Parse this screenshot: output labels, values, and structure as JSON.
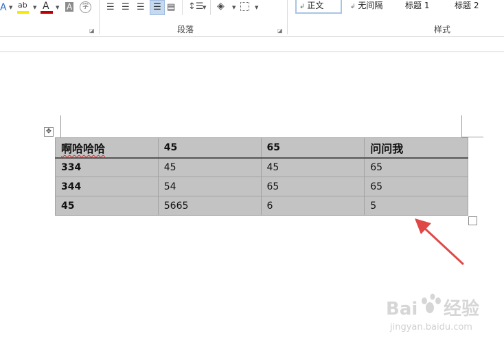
{
  "ribbon": {
    "font_icons": [
      "text-effects-icon",
      "highlight-icon",
      "font-color-icon",
      "character-shading-icon",
      "enclosed-character-icon"
    ],
    "paragraph_group_label": "段落",
    "styles_group_label": "样式",
    "styles": [
      {
        "prefix": "↲",
        "label": "正文",
        "selected": true
      },
      {
        "prefix": "↲",
        "label": "无间隔",
        "selected": false
      },
      {
        "prefix": "",
        "label": "标题 1",
        "selected": false
      },
      {
        "prefix": "",
        "label": "标题 2",
        "selected": false
      }
    ],
    "colors": {
      "highlight": "#f5ea00",
      "font_color": "#c00000",
      "accent": "#a7c4e6"
    }
  },
  "table": {
    "header": [
      "啊哈哈哈",
      "45",
      "65",
      "问问我"
    ],
    "rows": [
      [
        "334",
        "45",
        "45",
        "65"
      ],
      [
        "344",
        "54",
        "65",
        "65"
      ],
      [
        "45",
        "5665",
        "6",
        "5"
      ]
    ],
    "cell_color": "#c3c3c3"
  },
  "annotation": {
    "arrow_color": "#e04848"
  },
  "watermark": {
    "brand": "Bai",
    "brand2": "经验",
    "url": "jingyan.baidu.com"
  }
}
